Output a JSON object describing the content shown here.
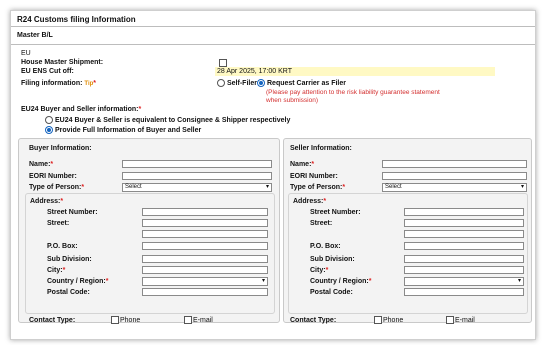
{
  "page": {
    "title": "R24 Customs filing Information",
    "master_bl": "Master B/L",
    "region": "EU"
  },
  "house_master": {
    "label": "House Master Shipment:",
    "checked": false
  },
  "cutoff": {
    "label": "EU ENS Cut off:",
    "value": "28 Apr 2025, 17:00 KRT"
  },
  "filing": {
    "label": "Filing information:",
    "hint": "Tip",
    "options": [
      "Self-Filer",
      "Request Carrier as Filer"
    ],
    "selected": "Request Carrier as Filer",
    "warning_line1": "(Please pay attention to the risk liability guarantee statement",
    "warning_line2": "when submission)"
  },
  "buyer_seller": {
    "label": "EU24 Buyer and Seller information:",
    "options": [
      "EU24 Buyer & Seller is equivalent to Consignee & Shipper respectively",
      "Provide Full Information of Buyer and Seller"
    ],
    "selected": "Provide Full Information of Buyer and Seller"
  },
  "buyer": {
    "heading": "Buyer Information:",
    "name": "Name:",
    "eori": "EORI Number:",
    "type": "Type of Person:",
    "type_value": "Select",
    "address": "Address:",
    "street_number": "Street Number:",
    "street": "Street:",
    "po_box": "P.O. Box:",
    "sub_division": "Sub Division:",
    "city": "City:",
    "country": "Country / Region:",
    "postal": "Postal Code:",
    "contact": "Contact Type:",
    "phone": "Phone",
    "email": "E-mail"
  },
  "seller": {
    "heading": "Seller Information:",
    "name": "Name:",
    "eori": "EORI Number:",
    "type": "Type of Person:",
    "type_value": "Select",
    "address": "Address:",
    "street_number": "Street Number:",
    "street": "Street:",
    "po_box": "P.O. Box:",
    "sub_division": "Sub Division:",
    "city": "City:",
    "country": "Country / Region:",
    "postal": "Postal Code:",
    "contact": "Contact Type:",
    "phone": "Phone",
    "email": "E-mail"
  },
  "required_mark": "*",
  "colors": {
    "accent": "#1565c0",
    "warning": "#d32f2f",
    "highlight": "#fff9c4",
    "hint": "#e08a00"
  }
}
